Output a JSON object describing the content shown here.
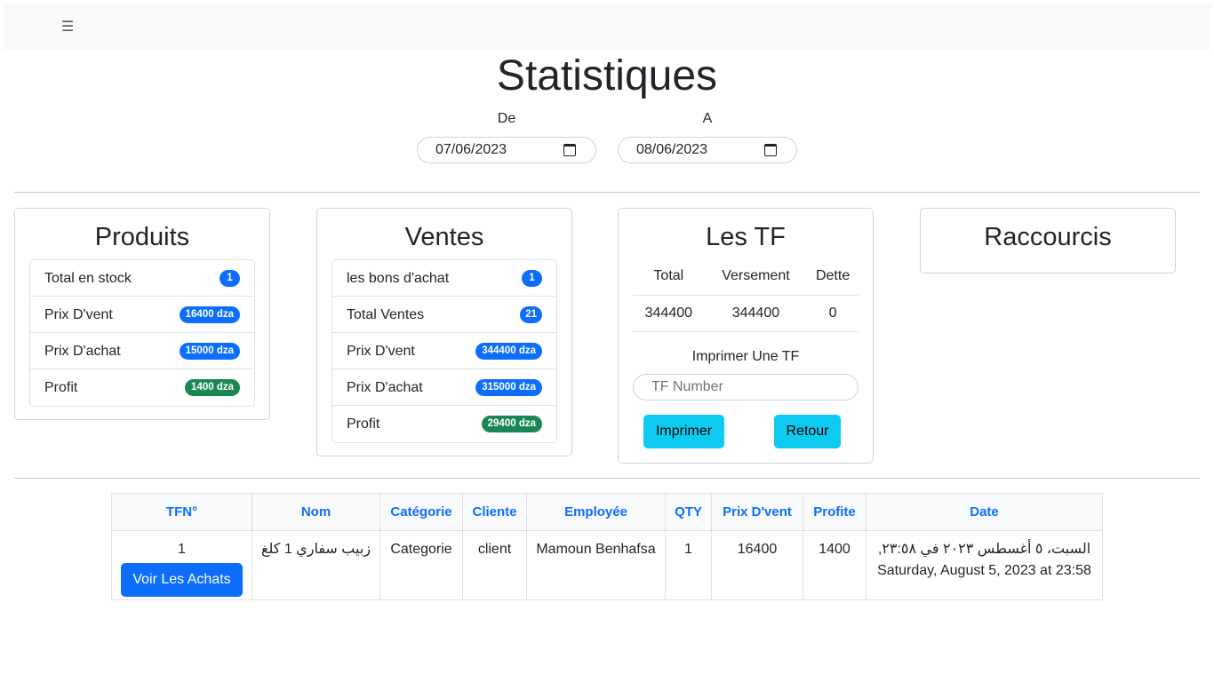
{
  "header": {
    "menu_icon": "hamburger-icon"
  },
  "page_title": "Statistiques",
  "date_filter": {
    "from_label": "De",
    "from_value": "07/06/2023",
    "to_label": "A",
    "to_value": "08/06/2023"
  },
  "produits": {
    "title": "Produits",
    "items": [
      {
        "label": "Total en stock",
        "value": "1"
      },
      {
        "label": "Prix D'vent",
        "value": "16400 dza"
      },
      {
        "label": "Prix D'achat",
        "value": "15000 dza"
      },
      {
        "label": "Profit",
        "value": "1400 dza"
      }
    ]
  },
  "ventes": {
    "title": "Ventes",
    "items": [
      {
        "label": "les bons d'achat",
        "value": "1"
      },
      {
        "label": "Total Ventes",
        "value": "21"
      },
      {
        "label": "Prix D'vent",
        "value": "344400 dza"
      },
      {
        "label": "Prix D'achat",
        "value": "315000 dza"
      },
      {
        "label": "Profit",
        "value": "29400 dza"
      }
    ]
  },
  "tf": {
    "title": "Les TF",
    "headers": [
      "Total",
      "Versement",
      "Dette"
    ],
    "values": [
      "344400",
      "344400",
      "0"
    ],
    "print_label": "Imprimer Une TF",
    "input_placeholder": "TF Number",
    "print_button": "Imprimer",
    "back_button": "Retour"
  },
  "raccourcis": {
    "title": "Raccourcis"
  },
  "table": {
    "headers": [
      "TFN°",
      "Nom",
      "Catégorie",
      "Cliente",
      "Employée",
      "QTY",
      "Prix D'vent",
      "Profite",
      "Date"
    ],
    "rows": [
      {
        "tfn": "1",
        "button": "Voir Les Achats",
        "nom": "زبيب سفاري 1 كلغ",
        "categorie": "Categorie",
        "cliente": "client",
        "employee": "Mamoun Benhafsa",
        "qty": "1",
        "prix": "16400",
        "profite": "1400",
        "date_ar": "السبت، ٥ أغسطس ٢٠٢٣ في ٢٣:٥٨,",
        "date_en": "Saturday, August 5, 2023 at 23:58"
      }
    ]
  },
  "colors": {
    "primary": "#0d6efd",
    "success": "#198754",
    "info": "#0dcaf0"
  }
}
